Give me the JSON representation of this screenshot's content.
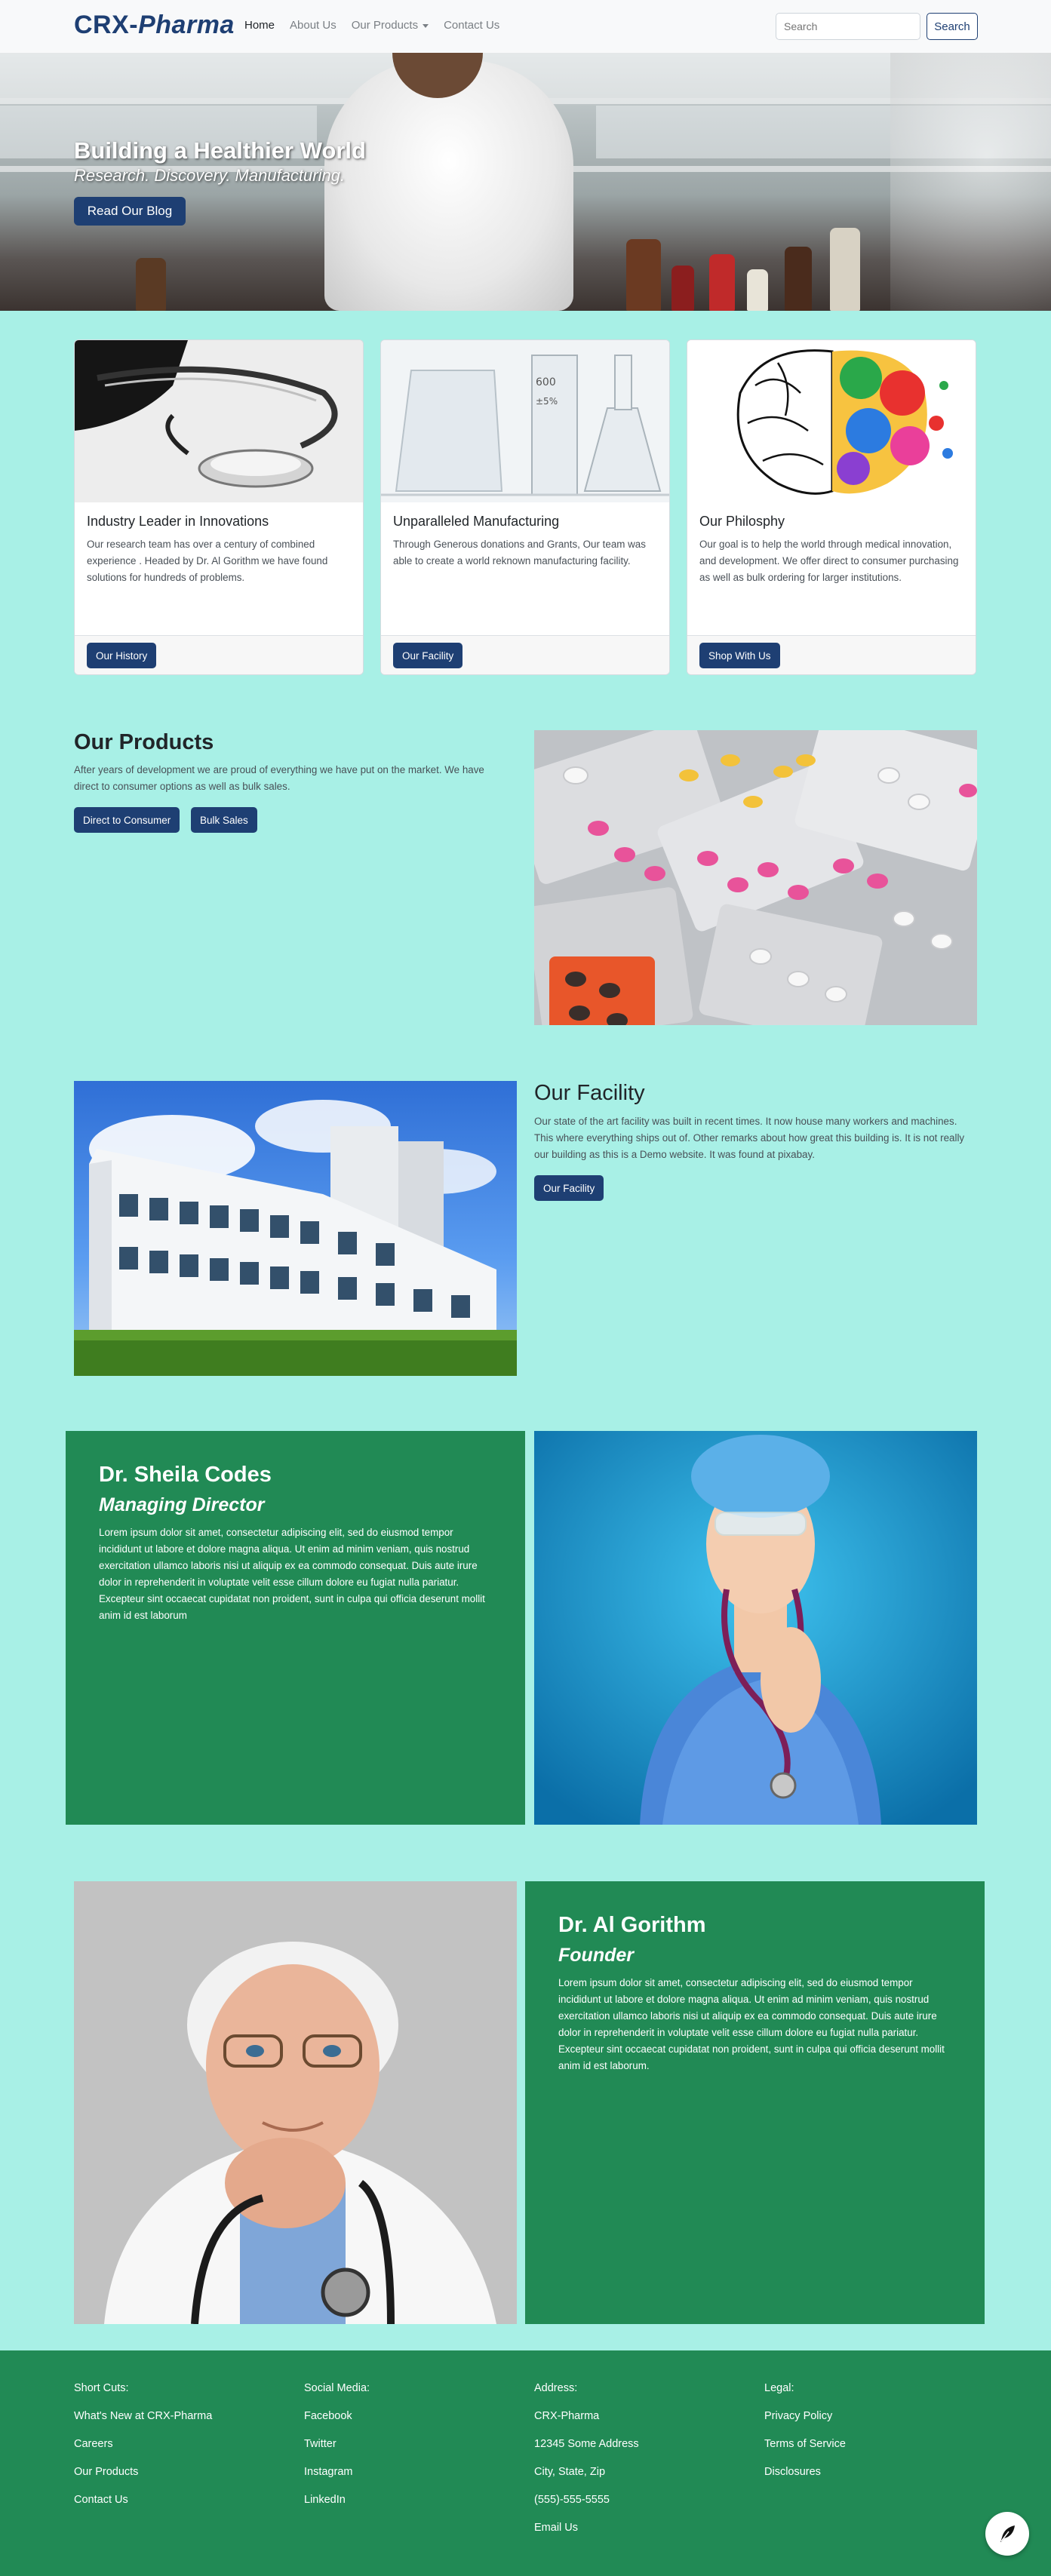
{
  "navbar": {
    "brand_part1": "CRX-",
    "brand_part2": "Pharma",
    "links": [
      "Home",
      "About Us",
      "Our Products",
      "Contact Us"
    ],
    "search_placeholder": "Search",
    "search_button": "Search"
  },
  "hero": {
    "title": "Building a Healthier World",
    "subtitle": "Research. Discovery. Manufacturing.",
    "button": "Read Our Blog"
  },
  "cards": [
    {
      "image_icon": "stethoscope-image",
      "title": "Industry Leader in Innovations",
      "text": "Our research team has over a century of combined experience . Headed by Dr. Al Gorithm we have found solutions for hundreds of problems.",
      "button": "Our History"
    },
    {
      "image_icon": "lab-glassware-image",
      "title": "Unparalleled Manufacturing",
      "text": "Through Generous donations and Grants, Our team was able to create a world reknown manufacturing facility.",
      "button": "Our Facility"
    },
    {
      "image_icon": "colorful-brain-image",
      "title": "Our Philosphy",
      "text": "Our goal is to help the world through medical innovation, and development. We offer direct to consumer purchasing as well as bulk ordering for larger institutions.",
      "button": "Shop With Us"
    }
  ],
  "products": {
    "title": "Our Products",
    "text": "After years of development we are proud of everything we have put on the market. We have direct to consumer options as well as bulk sales.",
    "button_direct": "Direct to Consumer",
    "button_bulk": "Bulk Sales",
    "image_icon": "pill-blister-image"
  },
  "facility": {
    "title": "Our Facility",
    "text": "Our state of the art facility was built in recent times. It now house many workers and machines. This where everything ships out of. Other remarks about how great this building is. It is not really our building as this is a Demo website. It was found at pixabay.",
    "button": "Our Facility",
    "image_icon": "office-building-image"
  },
  "people": [
    {
      "name": "Dr. Sheila Codes",
      "role": "Managing Director",
      "bio": "Lorem ipsum dolor sit amet, consectetur adipiscing elit, sed do eiusmod tempor incididunt ut labore et dolore magna aliqua. Ut enim ad minim veniam, quis nostrud exercitation ullamco laboris nisi ut aliquip ex ea commodo consequat. Duis aute irure dolor in reprehenderit in voluptate velit esse cillum dolore eu fugiat nulla pariatur. Excepteur sint occaecat cupidatat non proident, sunt in culpa qui officia deserunt mollit anim id est laborum",
      "photo_icon": "female-doctor-photo"
    },
    {
      "name": "Dr. Al Gorithm",
      "role": "Founder",
      "bio": "Lorem ipsum dolor sit amet, consectetur adipiscing elit, sed do eiusmod tempor incididunt ut labore et dolore magna aliqua. Ut enim ad minim veniam, quis nostrud exercitation ullamco laboris nisi ut aliquip ex ea commodo consequat. Duis aute irure dolor in reprehenderit in voluptate velit esse cillum dolore eu fugiat nulla pariatur. Excepteur sint occaecat cupidatat non proident, sunt in culpa qui officia deserunt mollit anim id est laborum.",
      "photo_icon": "senior-doctor-photo"
    }
  ],
  "footer": {
    "shortcuts": {
      "heading": "Short Cuts:",
      "items": [
        "What's New at CRX-Pharma",
        "Careers",
        "Our Products",
        "Contact Us"
      ]
    },
    "social": {
      "heading": "Social Media:",
      "items": [
        "Facebook",
        "Twitter",
        "Instagram",
        "LinkedIn"
      ]
    },
    "address": {
      "heading": "Address:",
      "items": [
        "CRX-Pharma",
        "12345 Some Address",
        "City, State, Zip",
        "(555)-555-5555",
        "Email Us"
      ]
    },
    "legal": {
      "heading": "Legal:",
      "items": [
        "Privacy Policy",
        "Terms of Service",
        "Disclosures"
      ]
    }
  },
  "chat_icon": "feather-pen-icon",
  "colors": {
    "navy": "#1e3f73",
    "page_bg": "#a8f0e6",
    "green": "#218a55",
    "navbar_bg": "#f8f9fa"
  }
}
